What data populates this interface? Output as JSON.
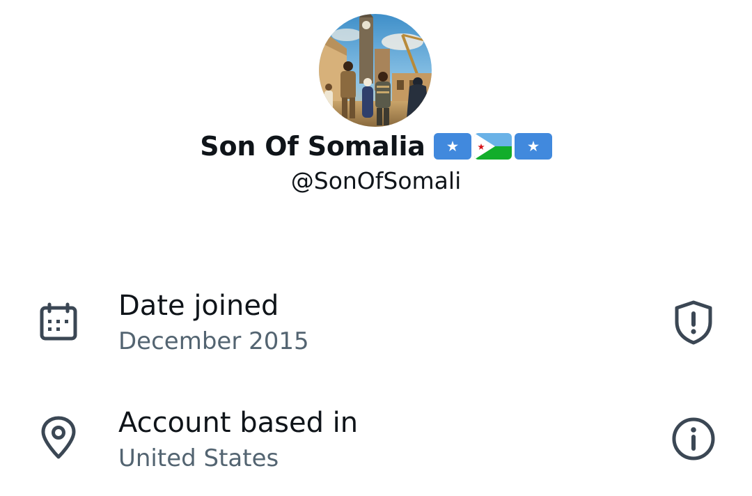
{
  "profile": {
    "display_name": "Son Of Somalia",
    "flags": [
      "somalia-flag",
      "djibouti-flag",
      "somalia-flag"
    ],
    "handle": "@SonOfSomali"
  },
  "about": {
    "date_joined": {
      "label": "Date joined",
      "value": "December 2015",
      "icon": "calendar-icon",
      "action_icon": "shield-alert-icon"
    },
    "account_based_in": {
      "label": "Account based in",
      "value": "United States",
      "icon": "location-pin-icon",
      "action_icon": "info-icon"
    }
  },
  "colors": {
    "text_primary": "#0f1419",
    "text_secondary": "#536471",
    "icon": "#3b4754",
    "somalia_blue": "#4189dd",
    "djibouti_blue": "#6ab2e7",
    "djibouti_green": "#12ad2b",
    "djibouti_star": "#d7141a"
  }
}
